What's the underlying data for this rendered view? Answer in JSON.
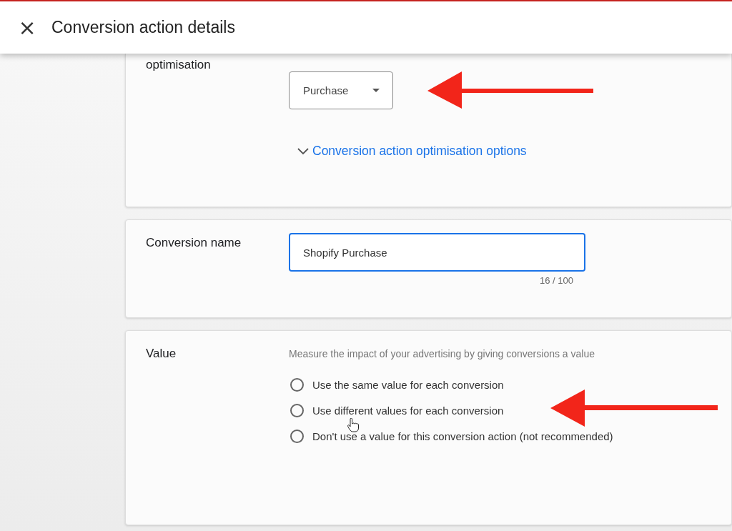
{
  "header": {
    "close_icon": "×",
    "title": "Conversion action details"
  },
  "optimisation": {
    "label": "optimisation",
    "dropdown": {
      "value": "Purchase"
    },
    "link": {
      "text": "Conversion action optimisation options",
      "expanded": false
    }
  },
  "conversion_name": {
    "label": "Conversion name",
    "field": {
      "value": "Shopify Purchase"
    },
    "counter": "16 / 100"
  },
  "value": {
    "label": "Value",
    "description": "Measure the impact of your advertising by giving conversions a value",
    "options": [
      {
        "label": "Use the same value for each conversion",
        "selected": false
      },
      {
        "label": "Use different values for each conversion",
        "selected": false
      },
      {
        "label": "Don't use a value for this conversion action (not recommended)",
        "selected": false
      }
    ]
  }
}
